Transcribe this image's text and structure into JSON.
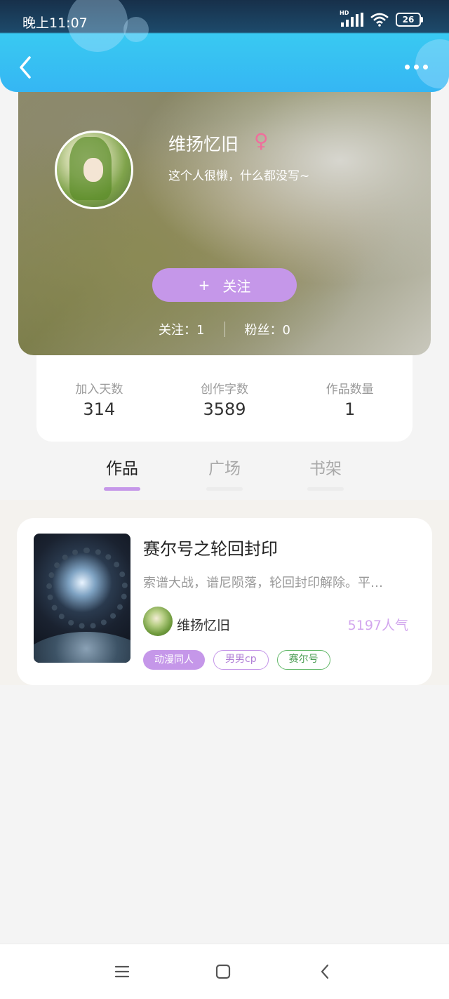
{
  "status_bar": {
    "time": "晚上11:07",
    "network_label": "HD",
    "battery": "26"
  },
  "profile": {
    "name": "维扬忆旧",
    "gender_symbol": "♀",
    "bio": "这个人很懒，什么都没写~",
    "follow_button": {
      "icon": "+",
      "label": "关注"
    },
    "following": "关注：1",
    "followers": "粉丝：0"
  },
  "stats": [
    {
      "label": "加入天数",
      "value": "314"
    },
    {
      "label": "创作字数",
      "value": "3589"
    },
    {
      "label": "作品数量",
      "value": "1"
    }
  ],
  "tabs": [
    {
      "label": "作品",
      "active": true
    },
    {
      "label": "广场",
      "active": false
    },
    {
      "label": "书架",
      "active": false
    }
  ],
  "works": [
    {
      "title": "赛尔号之轮回封印",
      "description": "索谱大战，谱尼陨落，轮回封印解除。平…",
      "author": "维扬忆旧",
      "popularity": "5197人气",
      "tags": [
        "动漫同人",
        "男男cp",
        "赛尔号"
      ]
    }
  ],
  "colors": {
    "accent": "#c597e9",
    "header_blue": "#35b6f3",
    "female_pink": "#ef6f9c",
    "tag_green": "#64b96a"
  },
  "icons": {
    "back": "chevron-left-icon",
    "more": "more-dots-icon",
    "nav_menu": "menu-icon",
    "nav_home": "home-square-icon",
    "nav_back": "back-triangle-icon"
  }
}
